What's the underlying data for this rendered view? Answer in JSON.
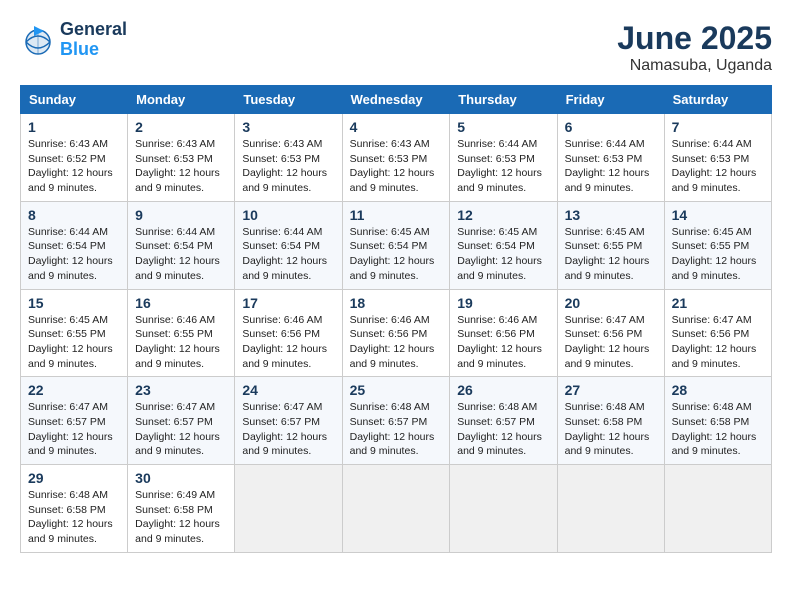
{
  "logo": {
    "general": "General",
    "blue": "Blue"
  },
  "title": {
    "month": "June 2025",
    "location": "Namasuba, Uganda"
  },
  "weekdays": [
    "Sunday",
    "Monday",
    "Tuesday",
    "Wednesday",
    "Thursday",
    "Friday",
    "Saturday"
  ],
  "weeks": [
    [
      {
        "day": "1",
        "sunrise": "6:43 AM",
        "sunset": "6:52 PM",
        "daylight": "12 hours and 9 minutes."
      },
      {
        "day": "2",
        "sunrise": "6:43 AM",
        "sunset": "6:53 PM",
        "daylight": "12 hours and 9 minutes."
      },
      {
        "day": "3",
        "sunrise": "6:43 AM",
        "sunset": "6:53 PM",
        "daylight": "12 hours and 9 minutes."
      },
      {
        "day": "4",
        "sunrise": "6:43 AM",
        "sunset": "6:53 PM",
        "daylight": "12 hours and 9 minutes."
      },
      {
        "day": "5",
        "sunrise": "6:44 AM",
        "sunset": "6:53 PM",
        "daylight": "12 hours and 9 minutes."
      },
      {
        "day": "6",
        "sunrise": "6:44 AM",
        "sunset": "6:53 PM",
        "daylight": "12 hours and 9 minutes."
      },
      {
        "day": "7",
        "sunrise": "6:44 AM",
        "sunset": "6:53 PM",
        "daylight": "12 hours and 9 minutes."
      }
    ],
    [
      {
        "day": "8",
        "sunrise": "6:44 AM",
        "sunset": "6:54 PM",
        "daylight": "12 hours and 9 minutes."
      },
      {
        "day": "9",
        "sunrise": "6:44 AM",
        "sunset": "6:54 PM",
        "daylight": "12 hours and 9 minutes."
      },
      {
        "day": "10",
        "sunrise": "6:44 AM",
        "sunset": "6:54 PM",
        "daylight": "12 hours and 9 minutes."
      },
      {
        "day": "11",
        "sunrise": "6:45 AM",
        "sunset": "6:54 PM",
        "daylight": "12 hours and 9 minutes."
      },
      {
        "day": "12",
        "sunrise": "6:45 AM",
        "sunset": "6:54 PM",
        "daylight": "12 hours and 9 minutes."
      },
      {
        "day": "13",
        "sunrise": "6:45 AM",
        "sunset": "6:55 PM",
        "daylight": "12 hours and 9 minutes."
      },
      {
        "day": "14",
        "sunrise": "6:45 AM",
        "sunset": "6:55 PM",
        "daylight": "12 hours and 9 minutes."
      }
    ],
    [
      {
        "day": "15",
        "sunrise": "6:45 AM",
        "sunset": "6:55 PM",
        "daylight": "12 hours and 9 minutes."
      },
      {
        "day": "16",
        "sunrise": "6:46 AM",
        "sunset": "6:55 PM",
        "daylight": "12 hours and 9 minutes."
      },
      {
        "day": "17",
        "sunrise": "6:46 AM",
        "sunset": "6:56 PM",
        "daylight": "12 hours and 9 minutes."
      },
      {
        "day": "18",
        "sunrise": "6:46 AM",
        "sunset": "6:56 PM",
        "daylight": "12 hours and 9 minutes."
      },
      {
        "day": "19",
        "sunrise": "6:46 AM",
        "sunset": "6:56 PM",
        "daylight": "12 hours and 9 minutes."
      },
      {
        "day": "20",
        "sunrise": "6:47 AM",
        "sunset": "6:56 PM",
        "daylight": "12 hours and 9 minutes."
      },
      {
        "day": "21",
        "sunrise": "6:47 AM",
        "sunset": "6:56 PM",
        "daylight": "12 hours and 9 minutes."
      }
    ],
    [
      {
        "day": "22",
        "sunrise": "6:47 AM",
        "sunset": "6:57 PM",
        "daylight": "12 hours and 9 minutes."
      },
      {
        "day": "23",
        "sunrise": "6:47 AM",
        "sunset": "6:57 PM",
        "daylight": "12 hours and 9 minutes."
      },
      {
        "day": "24",
        "sunrise": "6:47 AM",
        "sunset": "6:57 PM",
        "daylight": "12 hours and 9 minutes."
      },
      {
        "day": "25",
        "sunrise": "6:48 AM",
        "sunset": "6:57 PM",
        "daylight": "12 hours and 9 minutes."
      },
      {
        "day": "26",
        "sunrise": "6:48 AM",
        "sunset": "6:57 PM",
        "daylight": "12 hours and 9 minutes."
      },
      {
        "day": "27",
        "sunrise": "6:48 AM",
        "sunset": "6:58 PM",
        "daylight": "12 hours and 9 minutes."
      },
      {
        "day": "28",
        "sunrise": "6:48 AM",
        "sunset": "6:58 PM",
        "daylight": "12 hours and 9 minutes."
      }
    ],
    [
      {
        "day": "29",
        "sunrise": "6:48 AM",
        "sunset": "6:58 PM",
        "daylight": "12 hours and 9 minutes."
      },
      {
        "day": "30",
        "sunrise": "6:49 AM",
        "sunset": "6:58 PM",
        "daylight": "12 hours and 9 minutes."
      },
      null,
      null,
      null,
      null,
      null
    ]
  ],
  "labels": {
    "sunrise": "Sunrise:",
    "sunset": "Sunset:",
    "daylight": "Daylight:"
  }
}
